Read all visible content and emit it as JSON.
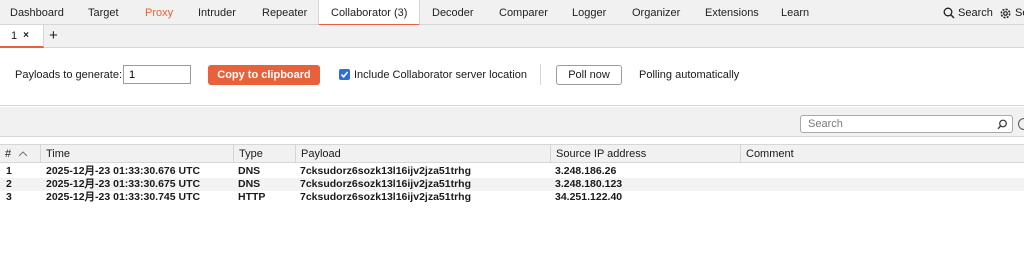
{
  "nav": {
    "tabs": [
      "Dashboard",
      "Target",
      "Proxy",
      "Intruder",
      "Repeater",
      "Collaborator (3)",
      "Decoder",
      "Comparer",
      "Logger",
      "Organizer",
      "Extensions",
      "Learn"
    ],
    "active_tab": "Collaborator (3)",
    "search_label": "Search",
    "settings_label": "Settings"
  },
  "subtabs": {
    "items": [
      "1"
    ],
    "close_glyph": "×",
    "add_glyph": "+"
  },
  "controls": {
    "payloads_label": "Payloads to generate:",
    "payloads_value": "1",
    "copy_button": "Copy to clipboard",
    "include_location_label": "Include Collaborator server location",
    "include_location_checked": true,
    "poll_button": "Poll now",
    "polling_status": "Polling automatically"
  },
  "search": {
    "placeholder": "Search"
  },
  "table": {
    "columns": [
      "#",
      "Time",
      "Type",
      "Payload",
      "Source IP address",
      "Comment"
    ],
    "rows": [
      {
        "num": "1",
        "time": "2025-12月-23 01:33:30.676 UTC",
        "type": "DNS",
        "payload": "7cksudorz6sozk13l16ijv2jza51trhg",
        "ip": "3.248.186.26",
        "comment": ""
      },
      {
        "num": "2",
        "time": "2025-12月-23 01:33:30.675 UTC",
        "type": "DNS",
        "payload": "7cksudorz6sozk13l16ijv2jza51trhg",
        "ip": "3.248.180.123",
        "comment": ""
      },
      {
        "num": "3",
        "time": "2025-12月-23 01:33:30.745 UTC",
        "type": "HTTP",
        "payload": "7cksudorz6sozk13l16ijv2jza51trhg",
        "ip": "34.251.122.40",
        "comment": ""
      }
    ]
  },
  "colors": {
    "accent": "#e8613b",
    "checkbox": "#2f6fd1",
    "panel": "#f1f1f1"
  }
}
